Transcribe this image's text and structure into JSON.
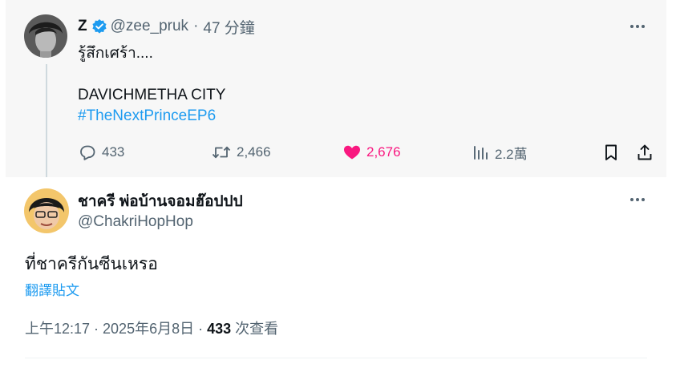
{
  "parent_tweet": {
    "display_name": "Z",
    "handle": "@zee_pruk",
    "separator": "·",
    "time_ago": "47 分鐘",
    "text_line_1": "รู้สึกเศร้า....",
    "text_line_2": "DAVICHMETHA CITY",
    "hashtag": "#TheNextPrinceEP6",
    "stats": {
      "replies": "433",
      "reposts": "2,466",
      "likes": "2,676",
      "views": "2.2萬"
    },
    "liked": true,
    "verified": true
  },
  "reply_tweet": {
    "display_name": "ชาครี พ่อบ้านจอมฮ๊อปปป",
    "handle": "@ChakriHopHop",
    "text": "ที่ชาครีกันซีนเหรอ",
    "translate_label": "翻譯貼文",
    "timestamp": "上午12:17 · 2025年6月8日 · ",
    "views_count": "433",
    "views_label": " 次查看"
  },
  "colors": {
    "accent": "#1d9bf0",
    "like": "#f91880",
    "secondary_text": "#536471",
    "parent_bg": "#f7f7f7"
  },
  "icons": [
    "verified-badge-icon",
    "more-icon",
    "reply-icon",
    "repost-icon",
    "like-icon",
    "views-icon",
    "bookmark-icon",
    "share-icon"
  ]
}
